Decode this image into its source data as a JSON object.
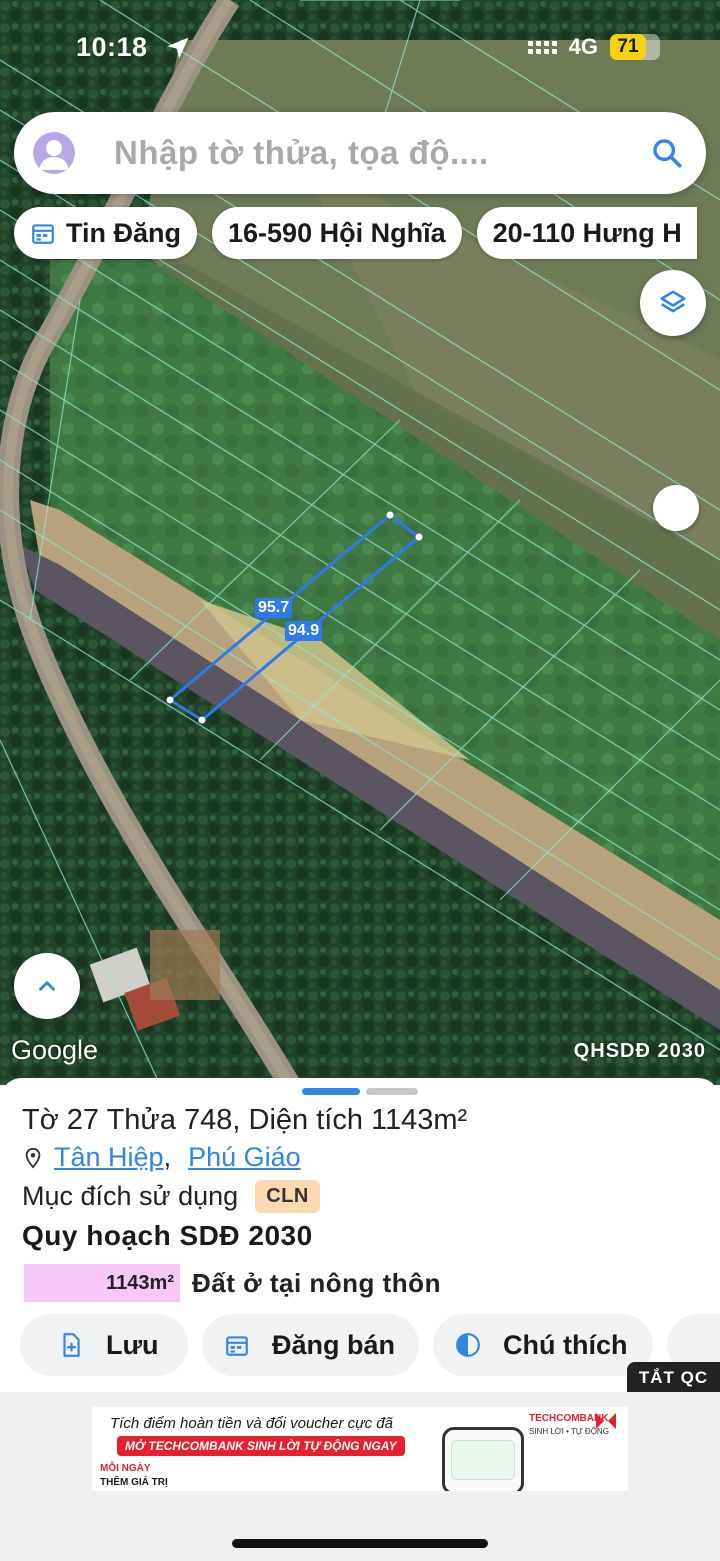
{
  "status_bar": {
    "time": "10:18",
    "network": "4G",
    "battery": "71",
    "battery_level": 0.71
  },
  "search": {
    "placeholder": "Nhập tờ thửa, tọa độ...."
  },
  "chips": [
    {
      "label": "Tin Đăng",
      "icon": "calendar-icon"
    },
    {
      "label": "16-590 Hội Nghĩa"
    },
    {
      "label": "20-110 Hưng H"
    }
  ],
  "map": {
    "measure_1": "95.7",
    "measure_2": "94.9",
    "attribution": "Google",
    "plan_layer": "QHSDĐ 2030",
    "colors": {
      "parcel_outline": "#2d7be8",
      "cadastral_lines": "#8fe8d6"
    }
  },
  "sheet": {
    "parcel_title": "Tờ 27 Thửa 748, Diện tích 1143m²",
    "ward": "Tân Hiệp",
    "separator": ",",
    "district": "Phú Giáo",
    "purpose_label": "Mục đích sử dụng",
    "purpose_code": "CLN",
    "plan_title": "Quy hoạch SDĐ 2030",
    "plan_area": "1143m²",
    "plan_use": "Đất ở tại nông thôn",
    "plan_color": "#f7c7f5"
  },
  "actions": {
    "save": "Lưu",
    "post": "Đăng bán",
    "legend": "Chú thích"
  },
  "ads": {
    "hide_label": "TẮT QC",
    "line1": "Tích điểm hoàn tiền và đổi voucher cực đã",
    "line2": "MỞ TECHCOMBANK SINH LỜI TỰ ĐỘNG NGAY",
    "line3": "MỖI NGÀY",
    "line4": "THÊM GIÁ TRỊ",
    "brand": "TECHCOMBANK",
    "tagline": "SINH LỜI • TỰ ĐỘNG"
  }
}
